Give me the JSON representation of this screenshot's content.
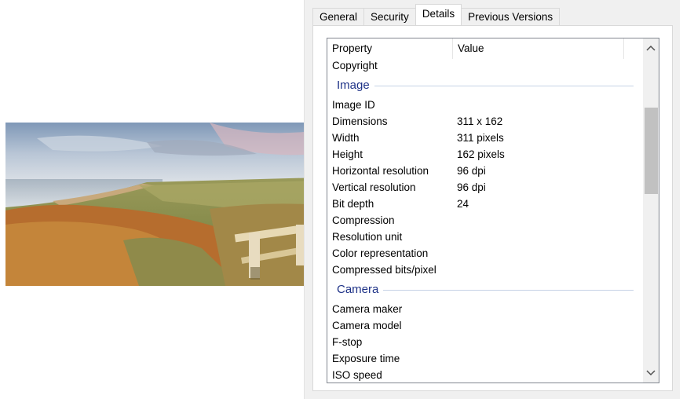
{
  "tabs": [
    {
      "label": "General",
      "active": false
    },
    {
      "label": "Security",
      "active": false
    },
    {
      "label": "Details",
      "active": true
    },
    {
      "label": "Previous Versions",
      "active": false
    }
  ],
  "list": {
    "headers": {
      "property": "Property",
      "value": "Value"
    },
    "top_rows": [
      {
        "property": "Copyright",
        "value": ""
      }
    ],
    "groups": [
      {
        "title": "Image",
        "rows": [
          {
            "property": "Image ID",
            "value": ""
          },
          {
            "property": "Dimensions",
            "value": "311 x 162"
          },
          {
            "property": "Width",
            "value": "311 pixels"
          },
          {
            "property": "Height",
            "value": "162 pixels"
          },
          {
            "property": "Horizontal resolution",
            "value": "96 dpi"
          },
          {
            "property": "Vertical resolution",
            "value": "96 dpi"
          },
          {
            "property": "Bit depth",
            "value": "24"
          },
          {
            "property": "Compression",
            "value": ""
          },
          {
            "property": "Resolution unit",
            "value": ""
          },
          {
            "property": "Color representation",
            "value": ""
          },
          {
            "property": "Compressed bits/pixel",
            "value": ""
          }
        ]
      },
      {
        "title": "Camera",
        "rows": [
          {
            "property": "Camera maker",
            "value": ""
          },
          {
            "property": "Camera model",
            "value": ""
          },
          {
            "property": "F-stop",
            "value": ""
          },
          {
            "property": "Exposure time",
            "value": ""
          },
          {
            "property": "ISO speed",
            "value": ""
          }
        ]
      }
    ]
  },
  "scrollbar": {
    "up_icon": "chevron-up-icon",
    "down_icon": "chevron-down-icon",
    "position_fraction": 0.2
  },
  "colors": {
    "group_title": "#1e3287",
    "tab_active_bg": "#ffffff",
    "dialog_bg": "#f0f0f0"
  }
}
